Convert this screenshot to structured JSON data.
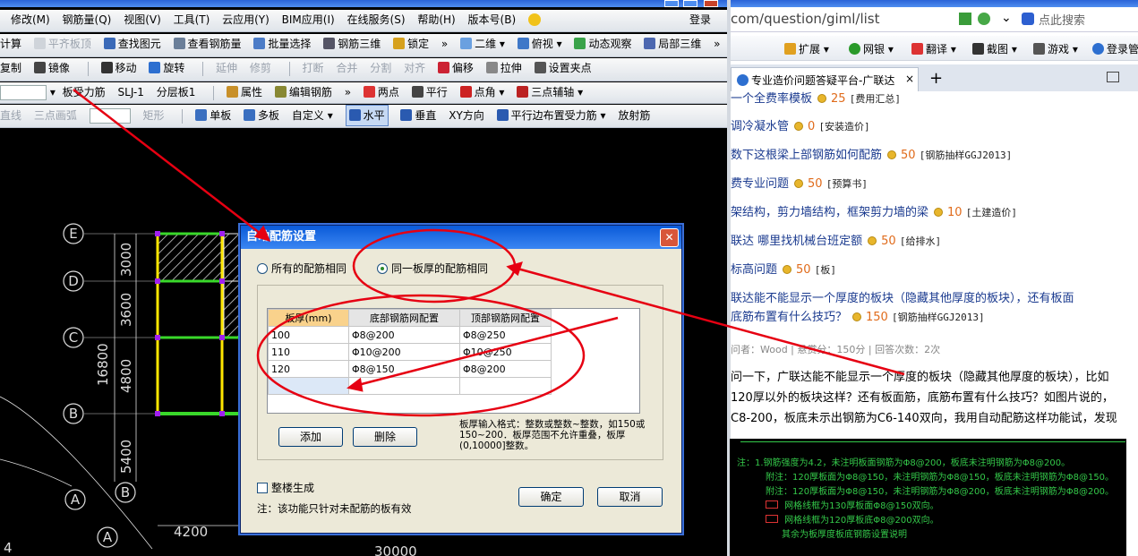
{
  "menu": [
    "修改(M)",
    "钢筋量(Q)",
    "视图(V)",
    "工具(T)",
    "云应用(Y)",
    "BIM应用(I)",
    "在线服务(S)",
    "帮助(H)",
    "版本号(B)",
    "登录"
  ],
  "toolbar1": [
    "计算",
    "平齐板顶",
    "查找图元",
    "查看钢筋量",
    "批量选择",
    "钢筋三维",
    "锁定",
    "二维",
    "俯视",
    "动态观察",
    "局部三维"
  ],
  "toolbar2": [
    "复制",
    "镜像",
    "移动",
    "旋转",
    "延伸",
    "修剪",
    "打断",
    "合并",
    "分割",
    "对齐",
    "偏移",
    "拉伸",
    "设置夹点"
  ],
  "toolbar3": {
    "combo1": "板受力筋",
    "combo2": "SLJ-1",
    "combo3": "分层板1",
    "items": [
      "属性",
      "编辑钢筋",
      "两点",
      "平行",
      "点角",
      "三点辅轴"
    ]
  },
  "toolbar4": [
    "直线",
    "三点画弧",
    "矩形",
    "单板",
    "多板",
    "自定义",
    "水平",
    "垂直",
    "XY方向",
    "平行边布置受力筋",
    "放射筋"
  ],
  "cad": {
    "axes": [
      "E",
      "D",
      "C",
      "B",
      "A",
      "B",
      "A"
    ],
    "dims_v": [
      "3000",
      "3600",
      "4800",
      "5400"
    ],
    "total_v": "16800",
    "dim_h": "4200",
    "total_h": "30000",
    "corner": "4"
  },
  "dialog": {
    "title": "自动配筋设置",
    "opt_all": "所有的配筋相同",
    "opt_same": "同一板厚的配筋相同",
    "col_thick": "板厚(mm)",
    "col_bottom": "底部钢筋网配置",
    "col_top": "顶部钢筋网配置",
    "rows": [
      [
        "100",
        "Φ8@200",
        "Φ8@250"
      ],
      [
        "110",
        "Φ10@200",
        "Φ10@250"
      ],
      [
        "120",
        "Φ8@150",
        "Φ8@200"
      ]
    ],
    "add": "添加",
    "delete": "删除",
    "hint": "板厚输入格式：整数或整数~整数，如150或150~200．板厚范围不允许重叠，板厚(0,10000]整数。",
    "whole": "整楼生成",
    "note": "注：该功能只针对未配筋的板有效",
    "ok": "确定",
    "cancel": "取消"
  },
  "browser": {
    "url": "com/question/giml/list",
    "search_placeholder": "点此搜索",
    "bookmarks": [
      "扩展",
      "网银",
      "翻译",
      "截图",
      "游戏",
      "登录管"
    ],
    "tab_title": "专业造价问题答疑平台-广联达"
  },
  "questions": [
    {
      "title": "一个全费率模板",
      "score": "25",
      "tag": "[费用汇总]"
    },
    {
      "title": "调冷凝水管",
      "score": "0",
      "tag": "[安装造价]"
    },
    {
      "title": "数下这根梁上部钢筋如何配筋",
      "score": "50",
      "tag": "[钢筋抽样GGJ2013]"
    },
    {
      "title": "费专业问题",
      "score": "50",
      "tag": "[预算书]"
    },
    {
      "title": "架结构，剪力墙结构，框架剪力墙的梁",
      "score": "10",
      "tag": "[土建造价]"
    },
    {
      "title": "联达 哪里找机械台班定额",
      "score": "50",
      "tag": "[给排水]"
    },
    {
      "title": "标高问题",
      "score": "50",
      "tag": "[板]"
    }
  ],
  "featured": {
    "line1": "联达能不能显示一个厚度的板块（隐藏其他厚度的板块），还有板面",
    "line2": "底筋布置有什么技巧？",
    "score": "150",
    "tag": "[钢筋抽样GGJ2013]",
    "meta": "问者：Wood  |  悬赏分：150分  |  回答次数：2次",
    "body1": "问一下，广联达能不能显示一个厚度的板块（隐藏其他厚度的板块），比如",
    "body2": "120厚以外的板块这样？还有板面筋，底筋布置有什么技巧？如图片说的，",
    "body3": "C8-200，板底未示出钢筋为C6-140双向，我用自动配筋这样功能试，发现"
  },
  "notes": [
    "注：1.钢筋强度为4.2，未注明板面钢筋为Φ8@200，板底未注明钢筋为Φ8@200。",
    "附注：120厚板面为Φ8@150，未注明钢筋为Φ8@150，板底未注明钢筋为Φ8@150。",
    "附注：120厚板面为Φ8@150，未注明钢筋为Φ8@200，板底未注明钢筋为Φ8@200。",
    "  网格线框为130厚板面Φ8@150双向。",
    "  网格线框为120厚板底Φ8@200双向。",
    "  其余为板厚度板底钢筋设置说明"
  ],
  "colors": {
    "accent": "#e60012",
    "cad_yellow": "#ffe600",
    "cad_green": "#39d82a",
    "note_green": "#34c94a"
  }
}
